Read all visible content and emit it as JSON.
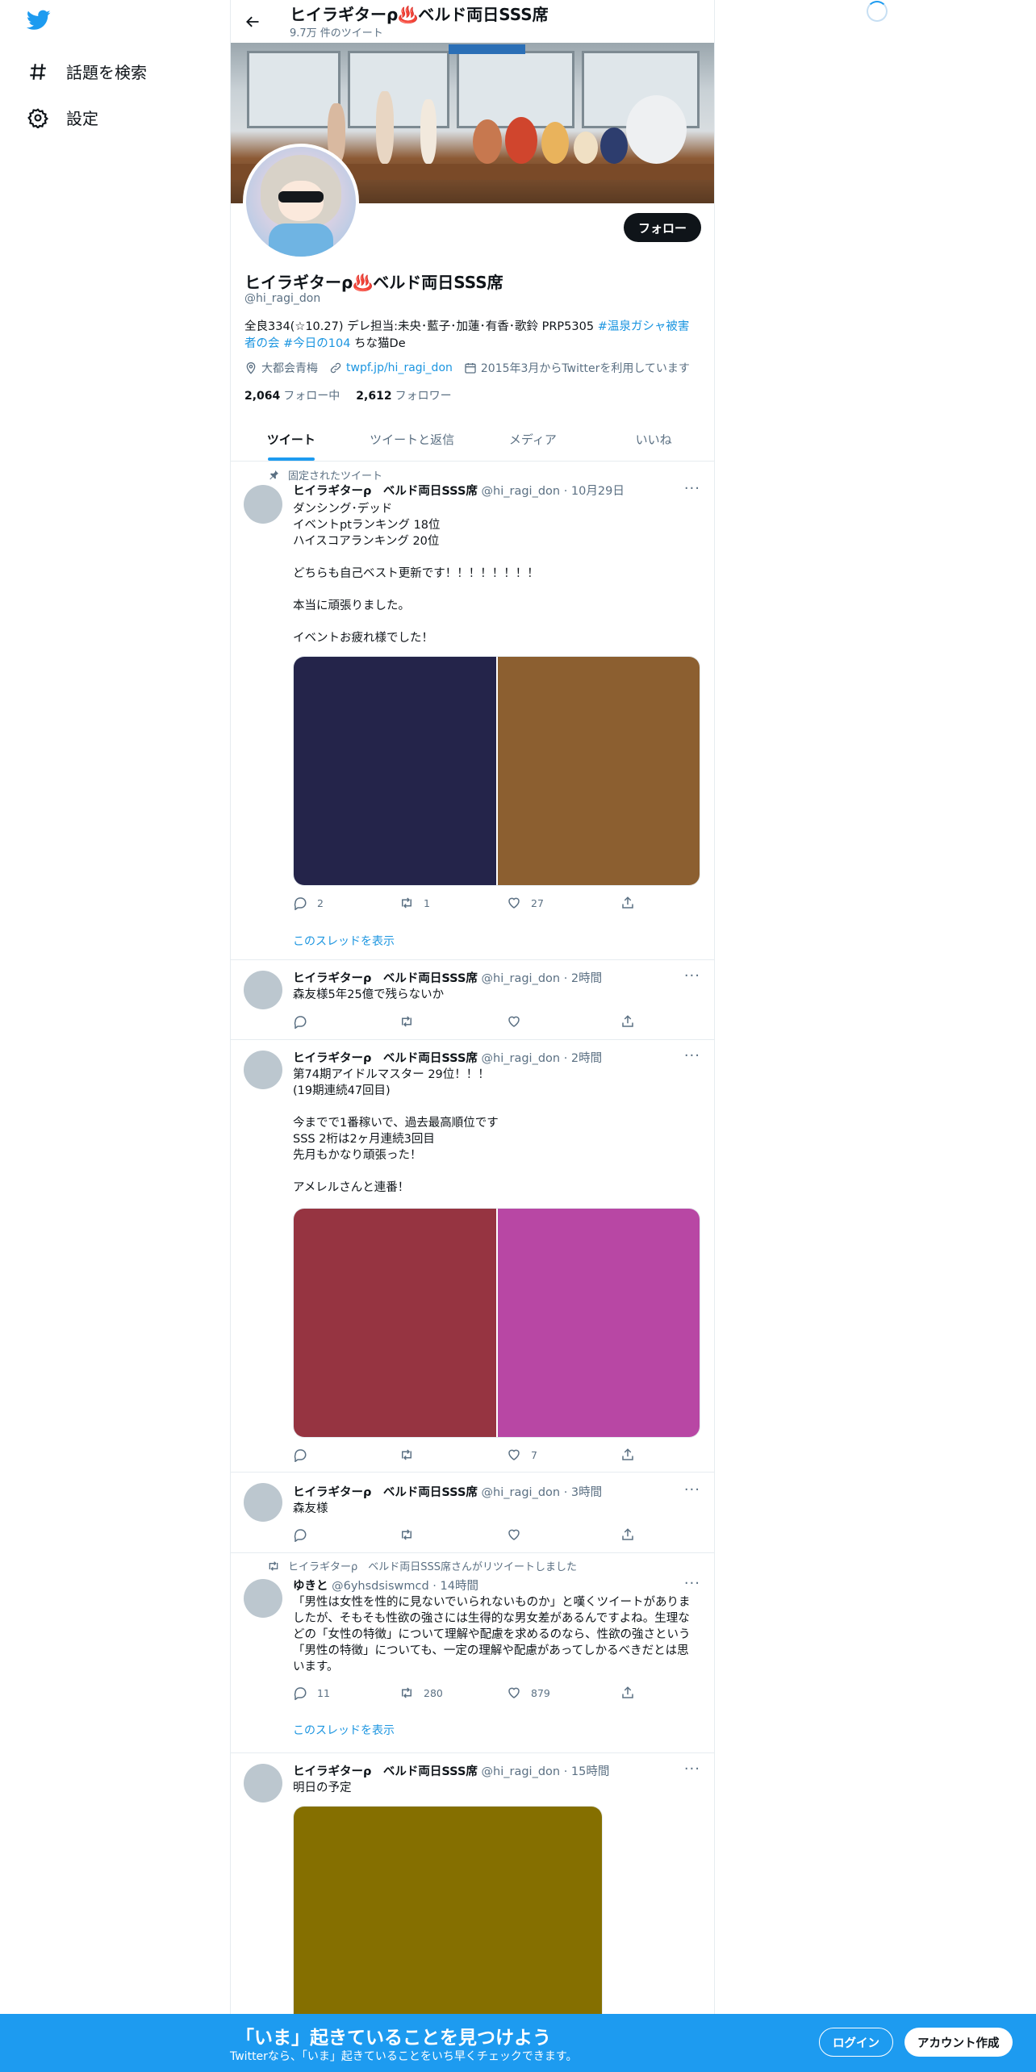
{
  "nav": {
    "explore_label": "話題を検索",
    "settings_label": "設定"
  },
  "header": {
    "title": "ヒイラギターρ♨️ベルド両日SSS席",
    "subtitle": "9.7万 件のツイート"
  },
  "profile": {
    "follow_label": "フォロー",
    "name": "ヒイラギターρ♨️ベルド両日SSS席",
    "handle": "@hi_ragi_don",
    "bio_text": "全良334(☆10.27) デレ担当:未央･藍子･加蓮･有香･歌鈴 PRP5305 ",
    "bio_link1": "#温泉ガシャ被害者の会",
    "bio_link2": "#今日の104",
    "bio_tail": " ちな猫De",
    "location": "大都会青梅",
    "url": "twpf.jp/hi_ragi_don",
    "joined": "2015年3月からTwitterを利用しています",
    "following_count": "2,064",
    "following_label": "フォロー中",
    "followers_count": "2,612",
    "followers_label": "フォロワー"
  },
  "tabs": [
    "ツイート",
    "ツイートと返信",
    "メディア",
    "いいね"
  ],
  "tweets": [
    {
      "social": "固定されたツイート",
      "name": "ヒイラギターρ　ベルド両日SSS席",
      "handle": "@hi_ragi_don",
      "time": "· 10月29日",
      "text": "ダンシング･デッド\nイベントptランキング 18位\nハイスコアランキング 20位\n\nどちらも自己ベスト更新です！！！！！！！！\n\n本当に頑張りました。\n\nイベントお疲れ様でした！",
      "media_colors": [
        "#24244a",
        "#8c5f30"
      ],
      "reply": "2",
      "retweet": "1",
      "like": "27",
      "show_thread": "このスレッドを表示"
    },
    {
      "name": "ヒイラギターρ　ベルド両日SSS席",
      "handle": "@hi_ragi_don",
      "time": "· 2時間",
      "text": "森友様5年25億で残らないか",
      "reply": "",
      "retweet": "",
      "like": ""
    },
    {
      "name": "ヒイラギターρ　ベルド両日SSS席",
      "handle": "@hi_ragi_don",
      "time": "· 2時間",
      "text": "第74期アイドルマスター 29位！！！\n(19期連続47回目)\n\n今までで1番稼いで、過去最高順位です\nSSS 2桁は2ヶ月連続3回目\n先月もかなり頑張った！\n\nアメレルさんと連番！",
      "media_colors": [
        "#963441",
        "#b847a4"
      ],
      "reply": "",
      "retweet": "",
      "like": "7"
    },
    {
      "name": "ヒイラギターρ　ベルド両日SSS席",
      "handle": "@hi_ragi_don",
      "time": "· 3時間",
      "text": "森友様",
      "reply": "",
      "retweet": "",
      "like": ""
    },
    {
      "social": "ヒイラギターρ　ベルド両日SSS席さんがリツイートしました",
      "name": "ゆきと",
      "handle": "@6yhsdsiswmcd",
      "time": "· 14時間",
      "text": "「男性は女性を性的に見ないでいられないものか」と嘆くツイートがありましたが、そもそも性欲の強さには生得的な男女差があるんですよね。生理などの「女性の特徴」について理解や配慮を求めるのなら、性欲の強さという「男性の特徴」についても、一定の理解や配慮があってしかるべきだとは思います。",
      "reply": "11",
      "retweet": "280",
      "like": "879",
      "show_thread": "このスレッドを表示"
    },
    {
      "name": "ヒイラギターρ　ベルド両日SSS席",
      "handle": "@hi_ragi_don",
      "time": "· 15時間",
      "text": "明日の予定",
      "media_colors": [
        "#856f00"
      ]
    }
  ],
  "bottombar": {
    "title": "「いま」起きていることを見つけよう",
    "subtitle": "Twitterなら、「いま」起きていることをいち早くチェックできます。",
    "login_label": "ログイン",
    "signup_label": "アカウント作成"
  },
  "colors": {
    "accent": "#1d9bf0",
    "link": "#1b95e0",
    "text_secondary": "#5b7083"
  }
}
